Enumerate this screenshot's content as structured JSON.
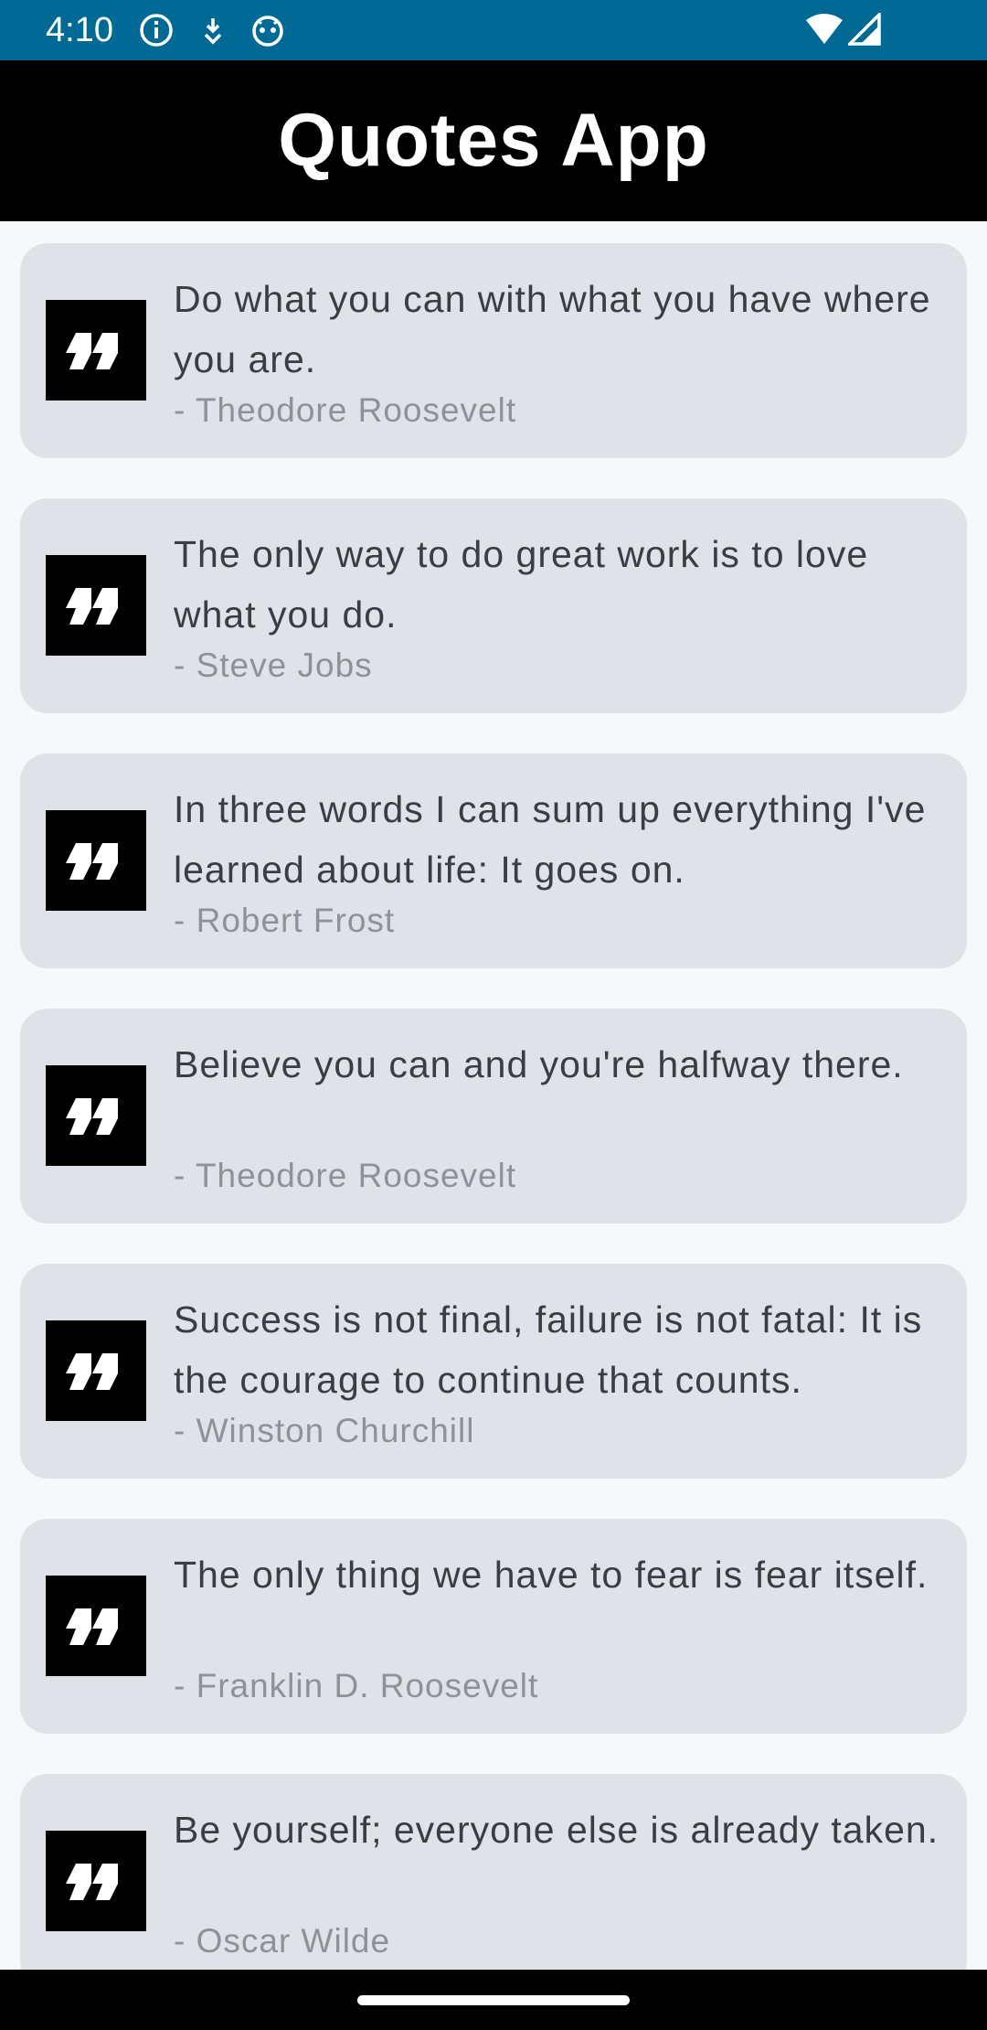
{
  "status_bar": {
    "time": "4:10",
    "icons": [
      "info-icon",
      "download-icon",
      "android-icon",
      "wifi-icon",
      "signal-icon"
    ],
    "background": "#006a94"
  },
  "app_bar": {
    "title": "Quotes App",
    "background": "#000000"
  },
  "quotes": [
    {
      "text": "Do what you can with what you have where you are.",
      "author": "- Theodore Roosevelt"
    },
    {
      "text": "The only way to do great work is to love what you do.",
      "author": "- Steve Jobs"
    },
    {
      "text": "In three words I can sum up everything I've learned about life: It goes on.",
      "author": "- Robert Frost"
    },
    {
      "text": "Believe you can and you're halfway there.",
      "author": "- Theodore Roosevelt"
    },
    {
      "text": "Success is not final, failure is not fatal: It is the courage to continue that counts.",
      "author": "- Winston Churchill"
    },
    {
      "text": "The only thing we have to fear is fear itself.",
      "author": "- Franklin D. Roosevelt"
    },
    {
      "text": "Be yourself; everyone else is already taken.",
      "author": "- Oscar Wilde"
    }
  ],
  "colors": {
    "card_background": "#dfe3e8",
    "quote_text": "#3a3d41",
    "author_text": "#8e9296",
    "page_background": "#f7f8fa"
  }
}
